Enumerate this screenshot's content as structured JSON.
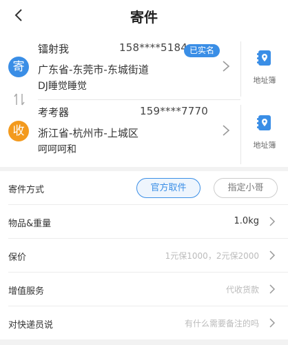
{
  "nav": {
    "title": "寄件",
    "back_icon": "chevron-left-icon"
  },
  "sender": {
    "badge": "寄",
    "name": "镭射我",
    "phone": "158****5184",
    "verified": "已实名",
    "region": "广东省-东莞市-东城街道",
    "detail": "DJ睡觉睡觉",
    "book_label": "地址簿"
  },
  "receiver": {
    "badge": "收",
    "name": "考考器",
    "phone": "159****7770",
    "region": "浙江省-杭州市-上城区",
    "detail": "呵呵呵和",
    "book_label": "地址簿"
  },
  "options": {
    "method": {
      "label": "寄件方式",
      "choices": [
        "官方取件",
        "指定小哥"
      ],
      "selected": "官方取件"
    },
    "goods": {
      "label": "物品&重量",
      "value": "1.0kg"
    },
    "insure": {
      "label": "保价",
      "placeholder": "1元保1000，2元保2000"
    },
    "value_added": {
      "label": "增值服务",
      "placeholder": "代收货款"
    },
    "note": {
      "label": "对快递员说",
      "placeholder": "有什么需要备注的吗"
    }
  },
  "colors": {
    "accent": "#3a8ee6",
    "orange": "#f39a1e"
  }
}
